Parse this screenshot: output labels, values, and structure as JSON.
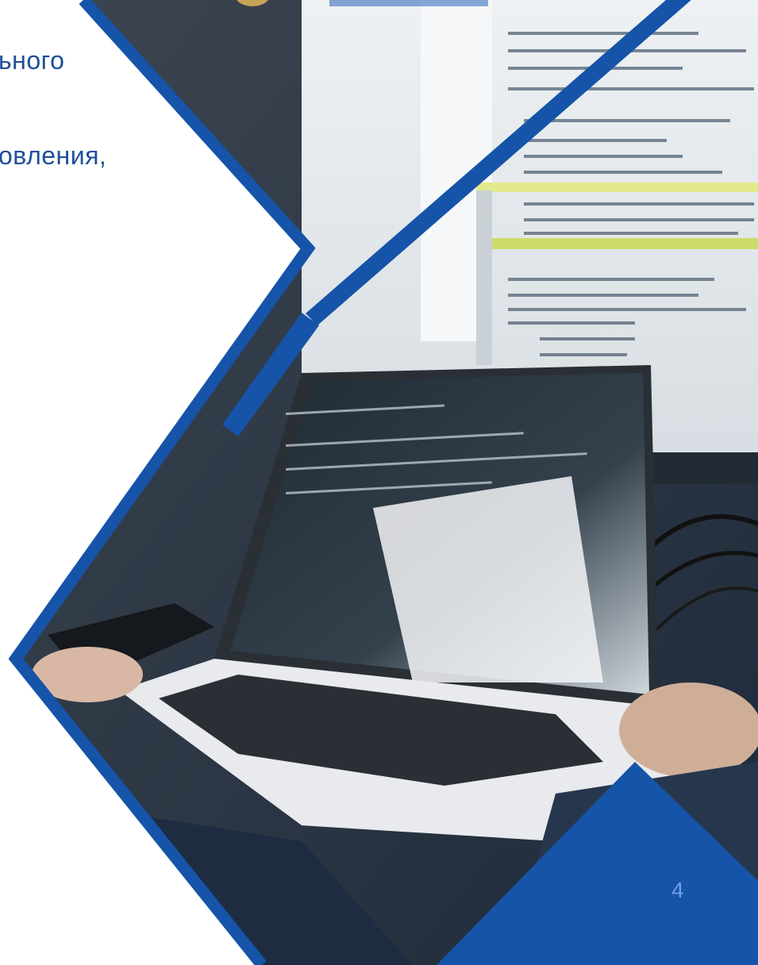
{
  "slide": {
    "text_lines": [
      "ьного",
      "овления,"
    ],
    "page_number": "4"
  },
  "photo": {
    "subject": "laptop-with-code"
  },
  "colors": {
    "brand_blue": "#1554a8",
    "text_blue": "#1d4f9a",
    "page_number": "#6f9be8",
    "background": "#ffffff"
  }
}
